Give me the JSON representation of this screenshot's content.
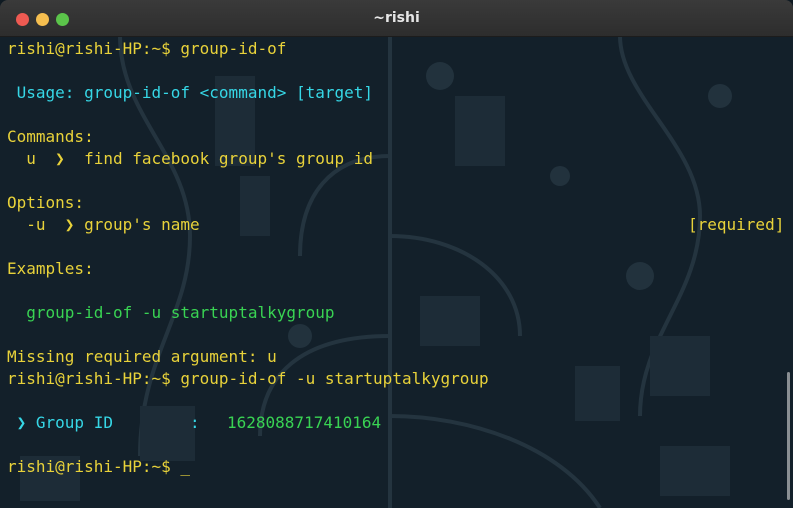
{
  "window": {
    "title": "~rishi"
  },
  "lines": {
    "l1": "rishi@rishi-HP:~$ group-id-of",
    "l2": " Usage: group-id-of <command> [target]",
    "l3": "Commands:",
    "l4_cmd": "  u  ❯  find facebook group's group id",
    "l5": "Options:",
    "l6_opt": "  -u  ❯ group's name",
    "l6_req": "[required]",
    "l7": "Examples:",
    "l8": "  group-id-of -u startuptalkygroup",
    "l9": "Missing required argument: u",
    "l10": "rishi@rishi-HP:~$ group-id-of -u startuptalkygroup",
    "l11_label": " ❯ Group ID        :",
    "l11_val": "1628088717410164",
    "l12": "rishi@rishi-HP:~$ _"
  },
  "colors": {
    "prompt": "#e8d23a",
    "usage": "#36d7e6",
    "example": "#39d353",
    "background": "#13202a"
  }
}
